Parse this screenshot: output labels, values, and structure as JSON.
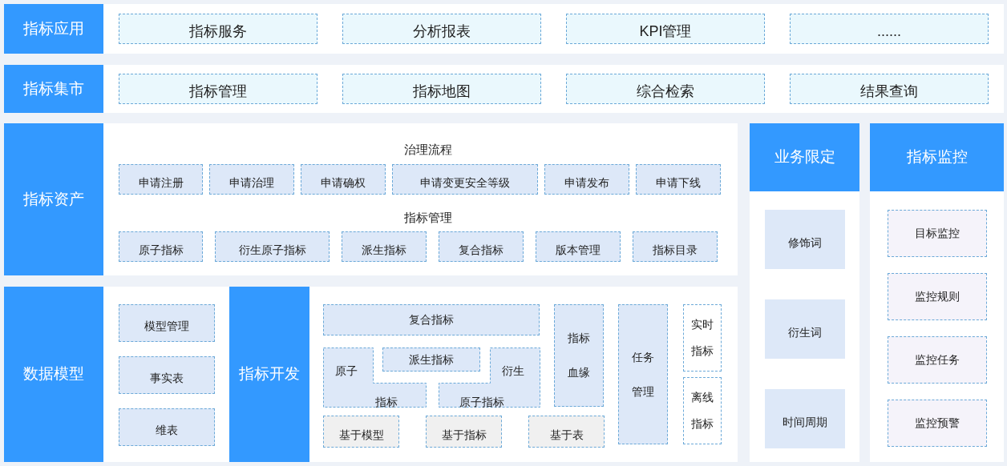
{
  "application_layer": {
    "label": "指标应用",
    "items": [
      "指标服务",
      "分析报表",
      "KPI管理",
      "......"
    ]
  },
  "market_layer": {
    "label": "指标集市",
    "items": [
      "指标管理",
      "指标地图",
      "综合检索",
      "结果查询"
    ]
  },
  "asset_layer": {
    "label": "指标资产",
    "groups": [
      {
        "title": "治理流程",
        "items": [
          "申请注册",
          "申请治理",
          "申请确权",
          "申请变更安全等级",
          "申请发布",
          "申请下线"
        ]
      },
      {
        "title": "指标管理",
        "items": [
          "原子指标",
          "衍生原子指标",
          "派生指标",
          "复合指标",
          "版本管理",
          "指标目录"
        ]
      }
    ]
  },
  "data_model": {
    "label": "数据模型",
    "items": [
      "模型管理",
      "事实表",
      "维表"
    ]
  },
  "development": {
    "label": "指标开发",
    "composite": "复合指标",
    "atomic": [
      "原子",
      "指标"
    ],
    "derived": "派生指标",
    "derived_atomic": [
      "衍生",
      "原子指标"
    ],
    "lineage": [
      "指标",
      "血缘"
    ],
    "task": [
      "任务",
      "管理"
    ],
    "realtime": [
      "实时",
      "指标"
    ],
    "offline": [
      "离线",
      "指标"
    ],
    "sources": [
      "基于模型",
      "基于指标",
      "基于表"
    ]
  },
  "business_qualifiers": {
    "label": "业务限定",
    "items": [
      "修饰词",
      "衍生词",
      "时间周期"
    ]
  },
  "monitoring": {
    "label": "指标监控",
    "items": [
      "目标监控",
      "监控规则",
      "监控任务",
      "监控预警"
    ]
  }
}
